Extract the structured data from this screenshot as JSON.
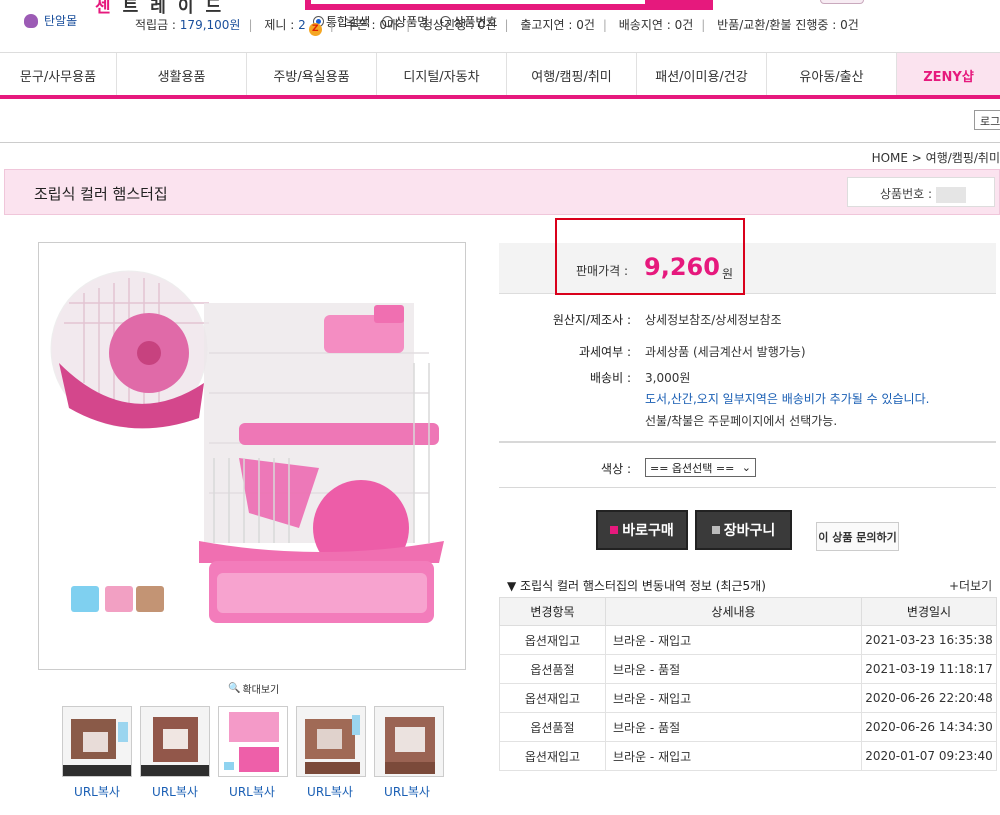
{
  "header": {
    "logo_first": "센",
    "logo_rest": "트레이드",
    "search_options": [
      "통합검색",
      "상품명",
      "상품번호"
    ]
  },
  "categories": [
    "문구/사무용품",
    "생활용품",
    "주방/욕실용품",
    "디지털/자동차",
    "여행/캠핑/취미",
    "패션/이미용/건강",
    "유아동/출산",
    "ZENY샵"
  ],
  "infobar": {
    "store_name": "탄알몰",
    "points_label": "적립금 : ",
    "points_value": "179,100원",
    "zeny_label": "제니 : ",
    "zeny_value": "2",
    "coupon_label": "쿠폰 : ",
    "coupon_value": "0매",
    "normal_label": "정상진행 : ",
    "normal_value": "0건",
    "delay_label": "출고지연 : ",
    "delay_value": "0건",
    "ship_delay_label": "배송지연 : ",
    "ship_delay_value": "0건",
    "return_label": "반품/교환/환불 진행중 : ",
    "return_value": "0건",
    "login_label": "로그"
  },
  "breadcrumb": "HOME > 여행/캠핑/취미",
  "product": {
    "title": "조립식 컬러 햄스터집",
    "number_label": "상품번호 :",
    "price_label": "판매가격 :",
    "price": "9,260",
    "price_unit": "원",
    "origin_label": "원산지/제조사 :",
    "origin_value": "상세정보참조/상세정보참조",
    "tax_label": "과세여부 :",
    "tax_value": "과세상품 (세금계산서 발행가능)",
    "shipping_label": "배송비 :",
    "shipping_value": "3,000원",
    "shipping_note1": "도서,산간,오지 일부지역은 배송비가 추가될 수 있습니다.",
    "shipping_note2": "선불/착불은 주문페이지에서 선택가능.",
    "color_label": "색상 :",
    "color_select": "== 옵션선택 ==",
    "buy_label": "바로구매",
    "cart_label": "장바구니",
    "inquiry_label": "이 상품 문의하기",
    "zoom_label": "확대보기",
    "url_copy": "URL복사",
    "thumb_caption": "조립식 컬러 햄스터집"
  },
  "history": {
    "title": "▼ 조립식 컬러 햄스터집의 변동내역 정보 (최근5개)",
    "more": "+더보기",
    "headers": [
      "변경항목",
      "상세내용",
      "변경일시"
    ],
    "rows": [
      [
        "옵션재입고",
        "브라운 - 재입고",
        "2021-03-23 16:35:38"
      ],
      [
        "옵션품절",
        "브라운 - 품절",
        "2021-03-19 11:18:17"
      ],
      [
        "옵션재입고",
        "브라운 - 재입고",
        "2020-06-26 22:20:48"
      ],
      [
        "옵션품절",
        "브라운 - 품절",
        "2020-06-26 14:34:30"
      ],
      [
        "옵션재입고",
        "브라운 - 재입고",
        "2020-01-07 09:23:40"
      ]
    ]
  },
  "colors": {
    "accent": "#e6197d",
    "swatches": [
      "#7fd0f0",
      "#f2a0c3",
      "#c39474"
    ]
  }
}
